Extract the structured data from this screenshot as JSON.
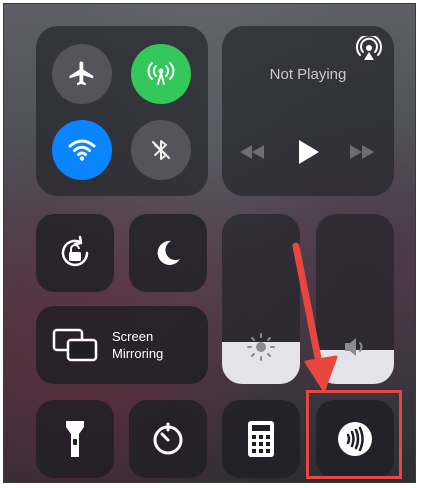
{
  "connectivity": {
    "airplane": {
      "icon": "airplane-icon",
      "state": "off"
    },
    "cellular": {
      "icon": "cellular-antenna-icon",
      "state": "on",
      "color": "#34c759"
    },
    "wifi": {
      "icon": "wifi-icon",
      "state": "on",
      "color": "#0a84ff"
    },
    "bluetooth": {
      "icon": "bluetooth-off-icon",
      "state": "off"
    }
  },
  "media": {
    "status": "Not Playing",
    "airplay_icon": "airplay-icon"
  },
  "tiles": {
    "rotation_lock_icon": "rotation-lock-icon",
    "do_not_disturb_icon": "moon-icon",
    "screen_mirroring_line1": "Screen",
    "screen_mirroring_line2": "Mirroring"
  },
  "sliders": {
    "brightness_level": 0.25,
    "volume_level": 0.2
  },
  "bottom_row": [
    {
      "name": "flashlight",
      "icon": "flashlight-icon"
    },
    {
      "name": "timer",
      "icon": "timer-icon"
    },
    {
      "name": "calculator",
      "icon": "calculator-icon"
    },
    {
      "name": "nfc-reader",
      "icon": "nfc-icon"
    }
  ],
  "annotation": {
    "arrow_color": "#e8473f",
    "highlight_color": "#e8473f"
  }
}
